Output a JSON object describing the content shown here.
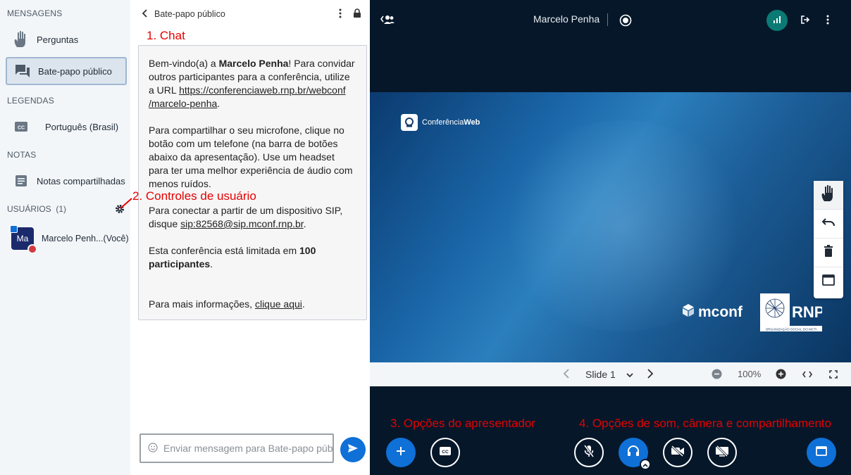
{
  "nav": {
    "messages_heading": "MENSAGENS",
    "questions_label": "Perguntas",
    "public_chat_label": "Bate-papo público",
    "captions_heading": "LEGENDAS",
    "captions_language": "Português (Brasil)",
    "notes_heading": "NOTAS",
    "shared_notes_label": "Notas compartilhadas",
    "users_heading": "USUÁRIOS",
    "users_count": "(1)",
    "user": {
      "initials": "Ma",
      "name": "Marcelo Penh...(Você)"
    }
  },
  "chat": {
    "title": "Bate-papo público",
    "welcome": {
      "p1_a": "Bem-vindo(a) a ",
      "p1_name": "Marcelo Penha",
      "p1_b": "! Para convidar outros participantes para a conferência, utilize a URL ",
      "p1_url_line1": "https://conferenciaweb.rnp.br/webconf",
      "p1_url_line2": "/marcelo-penha",
      "p1_c": ".",
      "p2": "Para compartilhar o seu microfone, clique no botão com um telefone (na barra de botões abaixo da apresentação). Use um headset para ter uma melhor experiência de áudio com menos ruídos.",
      "p3_a": "Para conectar a partir de um dispositivo SIP, disque ",
      "p3_sip": "sip:82568@sip.mconf.rnp.br",
      "p3_b": ".",
      "p4_a": "Esta conferência está limitada em ",
      "p4_bold": "100 participantes",
      "p4_b": ".",
      "p5_a": "Para mais informações, ",
      "p5_link": "clique aqui",
      "p5_b": "."
    },
    "input_placeholder": "Enviar mensagem para Bate-papo público"
  },
  "topbar": {
    "title": "Marcelo Penha"
  },
  "slide": {
    "brand_conferencia": "Conferência",
    "brand_web": "Web",
    "brand_mconf": "mconf",
    "brand_rnp": "RNP",
    "brand_rnp_sub": "ORGANIZAÇÃO SOCIAL DO MCTI"
  },
  "slide_controls": {
    "slide_label": "Slide 1",
    "zoom": "100%"
  },
  "annotations": {
    "a1": "1. Chat",
    "a2": "2. Controles de usuário",
    "a3": "3. Opções do apresentador",
    "a4": "4. Opções de som, câmera e compartilhamento"
  },
  "colors": {
    "accent": "#0f70d7",
    "annotation": "#e60000",
    "main_bg": "#06172a",
    "connection": "#0b7a74"
  }
}
